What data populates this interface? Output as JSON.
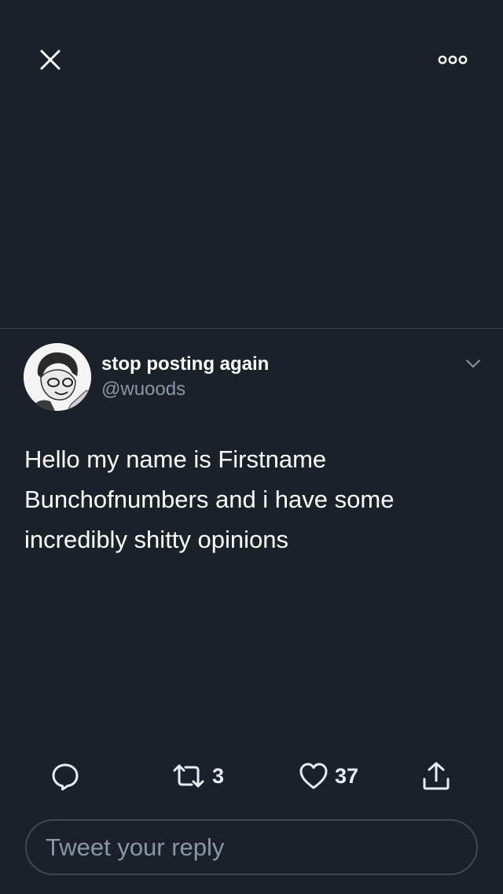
{
  "tweet": {
    "author": {
      "display_name": "stop posting again",
      "handle": "@wuoods"
    },
    "text": "Hello my name is Firstname Bunchofnumbers and i have some incredibly shitty opinions"
  },
  "actions": {
    "reply_icon": "reply-icon",
    "retweet_icon": "retweet-icon",
    "retweet_count": "3",
    "like_icon": "heart-icon",
    "like_count": "37",
    "share_icon": "share-icon"
  },
  "reply_input": {
    "placeholder": "Tweet your reply"
  },
  "colors": {
    "background": "#1b212b",
    "text_primary": "#ffffff",
    "text_secondary": "#8a96a3",
    "divider": "#3a4452"
  }
}
